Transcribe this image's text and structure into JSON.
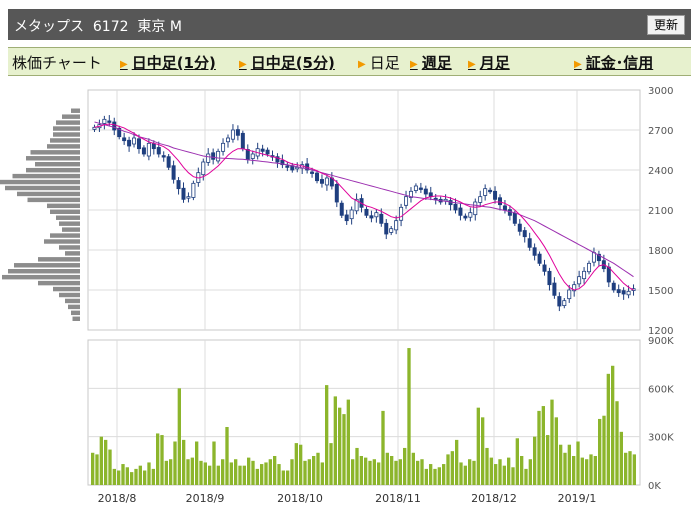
{
  "header": {
    "title": "メタップス  6172  東京 M",
    "refresh_label": "更新"
  },
  "tabs": [
    {
      "label": "株価チャート",
      "link": false,
      "marker": false
    },
    {
      "label": "日中足(1分)",
      "link": true,
      "marker": true
    },
    {
      "label": "日中足(5分)",
      "link": true,
      "marker": true
    },
    {
      "label": "日足",
      "link": false,
      "marker": true
    },
    {
      "label": "週足",
      "link": true,
      "marker": true
    },
    {
      "label": "月足",
      "link": true,
      "marker": true
    },
    {
      "label": "証金･信用",
      "link": true,
      "marker": true
    }
  ],
  "colors": {
    "header_bg": "#575757",
    "tab_bg": "#e7f1ce",
    "candle": "#1f3f7f",
    "ma_short": "#e0009a",
    "ma_long": "#9c2fb0",
    "volume": "#8cb52c",
    "profile": "#8c8c8c"
  },
  "chart_data": [
    {
      "type": "candlestick",
      "title": "",
      "ylim": [
        1200,
        3000
      ],
      "y_ticks": [
        "3000",
        "2700",
        "2400",
        "2100",
        "1800",
        "1500",
        "1200"
      ],
      "x_tick_labels": [
        "2018/8",
        "2018/9",
        "2018/10",
        "2018/11",
        "2018/12",
        "2019/1"
      ],
      "close": [
        2720,
        2740,
        2780,
        2760,
        2700,
        2650,
        2620,
        2580,
        2640,
        2560,
        2520,
        2600,
        2560,
        2520,
        2500,
        2420,
        2330,
        2260,
        2180,
        2200,
        2300,
        2380,
        2460,
        2520,
        2480,
        2540,
        2600,
        2640,
        2700,
        2660,
        2560,
        2480,
        2520,
        2560,
        2540,
        2520,
        2500,
        2460,
        2440,
        2430,
        2400,
        2420,
        2440,
        2400,
        2380,
        2320,
        2300,
        2340,
        2280,
        2160,
        2060,
        2020,
        2100,
        2180,
        2120,
        2060,
        2040,
        2080,
        2000,
        1920,
        1960,
        2020,
        2120,
        2200,
        2240,
        2280,
        2260,
        2220,
        2200,
        2180,
        2160,
        2180,
        2140,
        2100,
        2060,
        2040,
        2080,
        2160,
        2200,
        2260,
        2240,
        2180,
        2140,
        2100,
        2060,
        2000,
        1940,
        1900,
        1820,
        1760,
        1700,
        1640,
        1540,
        1460,
        1380,
        1420,
        1500,
        1540,
        1600,
        1640,
        1700,
        1780,
        1720,
        1660,
        1560,
        1500,
        1480,
        1470,
        1490,
        1510
      ],
      "ma_short": [
        2720,
        2727,
        2740,
        2745,
        2740,
        2727,
        2716,
        2695,
        2675,
        2650,
        2630,
        2610,
        2600,
        2590,
        2575,
        2550,
        2510,
        2470,
        2420,
        2380,
        2350,
        2340,
        2350,
        2370,
        2400,
        2430,
        2470,
        2510,
        2540,
        2560,
        2560,
        2550,
        2540,
        2530,
        2520,
        2510,
        2500,
        2490,
        2480,
        2460,
        2445,
        2440,
        2430,
        2420,
        2410,
        2395,
        2375,
        2360,
        2340,
        2310,
        2270,
        2230,
        2190,
        2170,
        2150,
        2130,
        2120,
        2105,
        2090,
        2070,
        2050,
        2040,
        2050,
        2080,
        2110,
        2140,
        2170,
        2190,
        2200,
        2205,
        2205,
        2200,
        2190,
        2175,
        2160,
        2140,
        2125,
        2120,
        2125,
        2140,
        2150,
        2160,
        2160,
        2150,
        2130,
        2100,
        2065,
        2025,
        1980,
        1930,
        1880,
        1825,
        1760,
        1690,
        1620,
        1560,
        1520,
        1500,
        1510,
        1540,
        1590,
        1640,
        1680,
        1690,
        1670,
        1630,
        1590,
        1550,
        1520,
        1500
      ],
      "ma_long": [
        2760,
        2750,
        2740,
        2730,
        2720,
        2705,
        2690,
        2680,
        2665,
        2650,
        2640,
        2630,
        2615,
        2600,
        2590,
        2580,
        2565,
        2555,
        2545,
        2535,
        2525,
        2515,
        2505,
        2500,
        2495,
        2490,
        2488,
        2486,
        2484,
        2482,
        2480,
        2476,
        2472,
        2468,
        2464,
        2460,
        2455,
        2450,
        2445,
        2440,
        2432,
        2424,
        2416,
        2408,
        2400,
        2390,
        2380,
        2370,
        2360,
        2350,
        2340,
        2330,
        2320,
        2310,
        2300,
        2290,
        2280,
        2270,
        2260,
        2250,
        2240,
        2230,
        2220,
        2210,
        2200,
        2195,
        2190,
        2185,
        2180,
        2175,
        2170,
        2165,
        2160,
        2155,
        2150,
        2145,
        2140,
        2135,
        2130,
        2125,
        2120,
        2112,
        2104,
        2096,
        2088,
        2080,
        2065,
        2050,
        2035,
        2020,
        2000,
        1980,
        1960,
        1940,
        1920,
        1900,
        1880,
        1860,
        1840,
        1820,
        1800,
        1780,
        1760,
        1740,
        1720,
        1700,
        1675,
        1650,
        1625,
        1600
      ]
    },
    {
      "type": "bar",
      "title": "",
      "ylim": [
        0,
        900000
      ],
      "y_ticks": [
        "900K",
        "600K",
        "300K",
        "0K"
      ],
      "values": [
        200000,
        190000,
        300000,
        280000,
        220000,
        100000,
        90000,
        130000,
        110000,
        80000,
        100000,
        120000,
        90000,
        140000,
        100000,
        320000,
        310000,
        150000,
        160000,
        270000,
        600000,
        280000,
        160000,
        170000,
        270000,
        150000,
        140000,
        120000,
        270000,
        120000,
        160000,
        360000,
        140000,
        160000,
        120000,
        120000,
        170000,
        150000,
        100000,
        130000,
        140000,
        160000,
        180000,
        130000,
        90000,
        90000,
        160000,
        260000,
        250000,
        150000,
        160000,
        180000,
        200000,
        140000,
        620000,
        260000,
        550000,
        480000,
        440000,
        530000,
        160000,
        230000,
        180000,
        170000,
        150000,
        160000,
        140000,
        460000,
        200000,
        180000,
        150000,
        160000,
        230000,
        850000,
        200000,
        150000,
        160000,
        100000,
        130000,
        100000,
        110000,
        130000,
        190000,
        210000,
        280000,
        140000,
        120000,
        160000,
        150000,
        480000,
        420000,
        230000,
        170000,
        130000,
        160000,
        120000,
        170000,
        110000,
        290000,
        180000,
        100000,
        160000,
        300000,
        460000,
        490000,
        310000,
        530000,
        420000,
        250000,
        200000,
        250000,
        180000,
        270000,
        170000,
        160000,
        190000,
        180000,
        410000,
        430000,
        690000,
        740000,
        520000,
        330000,
        200000,
        210000,
        190000
      ]
    }
  ],
  "price_profile": [
    0.06,
    0.12,
    0.16,
    0.18,
    0.18,
    0.2,
    0.22,
    0.33,
    0.36,
    0.3,
    0.36,
    0.45,
    0.55,
    0.5,
    0.42,
    0.35,
    0.22,
    0.2,
    0.16,
    0.14,
    0.12,
    0.2,
    0.24,
    0.14,
    0.1,
    0.28,
    0.44,
    0.48,
    0.52,
    0.28,
    0.18,
    0.14,
    0.1,
    0.08,
    0.06,
    0.05
  ]
}
